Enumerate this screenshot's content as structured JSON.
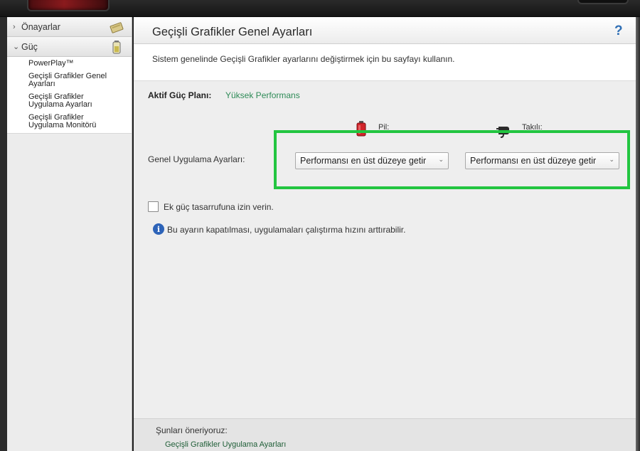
{
  "sidebar": {
    "sections": [
      {
        "label": "Önayarlar",
        "expanded": false,
        "icon": "preset-card-icon"
      },
      {
        "label": "Güç",
        "expanded": true,
        "icon": "battery-icon"
      }
    ],
    "power_items": [
      {
        "label": "PowerPlay™"
      },
      {
        "label": "Geçişli Grafikler Genel Ayarları"
      },
      {
        "label": "Geçişli Grafikler Uygulama Ayarları"
      },
      {
        "label": "Geçişli Grafikler Uygulama Monitörü"
      }
    ]
  },
  "main": {
    "title": "Geçişli Grafikler Genel Ayarları",
    "help_icon": "question-mark-icon",
    "description": "Sistem genelinde Geçişli Grafikler ayarlarını değiştirmek için bu sayfayı kullanın.",
    "plan_label": "Aktif Güç Planı:",
    "plan_value": "Yüksek Performans",
    "columns": {
      "battery_label": "Pil:",
      "plugged_label": "Takılı:"
    },
    "row_label": "Genel Uygulama Ayarları:",
    "battery_select": "Performansı en üst düzeye getir",
    "plugged_select": "Performansı en üst düzeye getir",
    "checkbox_label": "Ek güç tasarrufuna izin verin.",
    "checkbox_checked": false,
    "info_text": "Bu ayarın kapatılması, uygulamaları çalıştırma hızını arttırabilir.",
    "suggest_title": "Şunları öneriyoruz:",
    "suggest_link": "Geçişli Grafikler Uygulama Ayarları"
  },
  "colors": {
    "accent_green": "#2e8b57",
    "highlight": "#22c540",
    "info_blue": "#2d63b8"
  }
}
